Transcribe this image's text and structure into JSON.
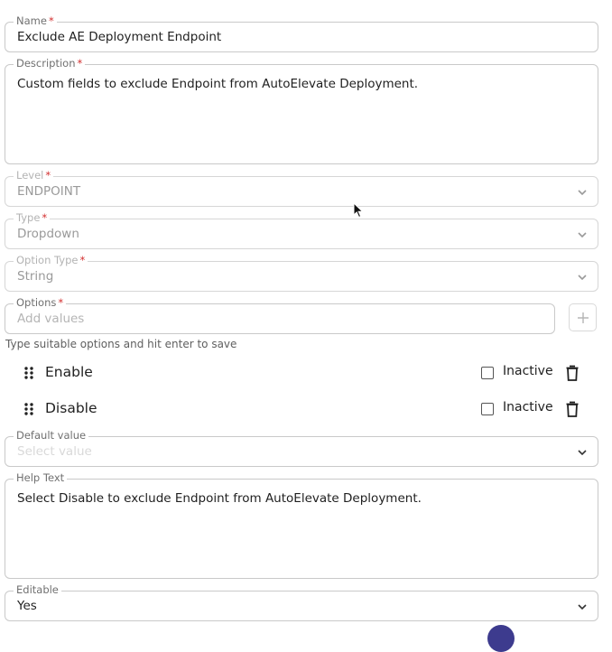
{
  "form": {
    "name": {
      "label": "Name",
      "required_mark": "*",
      "value": "Exclude AE Deployment Endpoint"
    },
    "description": {
      "label": "Description",
      "required_mark": "*",
      "value": "Custom fields to exclude Endpoint from AutoElevate Deployment."
    },
    "level": {
      "label": "Level",
      "required_mark": "*",
      "value": "ENDPOINT",
      "disabled": true
    },
    "type": {
      "label": "Type",
      "required_mark": "*",
      "value": "Dropdown",
      "disabled": true
    },
    "option_type": {
      "label": "Option Type",
      "required_mark": "*",
      "value": "String",
      "disabled": true
    },
    "options": {
      "label": "Options",
      "required_mark": "*",
      "placeholder": "Add values",
      "hint": "Type suitable options and hit enter to save"
    },
    "option_items": [
      {
        "label": "Enable",
        "inactive_label": "Inactive",
        "inactive": false
      },
      {
        "label": "Disable",
        "inactive_label": "Inactive",
        "inactive": false
      }
    ],
    "default_value": {
      "label": "Default value",
      "placeholder": "Select value"
    },
    "help_text": {
      "label": "Help Text",
      "value": "Select Disable to exclude Endpoint from AutoElevate Deployment."
    },
    "editable": {
      "label": "Editable",
      "value": "Yes"
    }
  },
  "colors": {
    "required": "#d32f2f",
    "border": "#c9c9c9",
    "accent": "#3d3b8e"
  },
  "icons": [
    "chevron-down-icon",
    "plus-icon",
    "drag-handle-icon",
    "trash-icon",
    "cursor-icon"
  ]
}
